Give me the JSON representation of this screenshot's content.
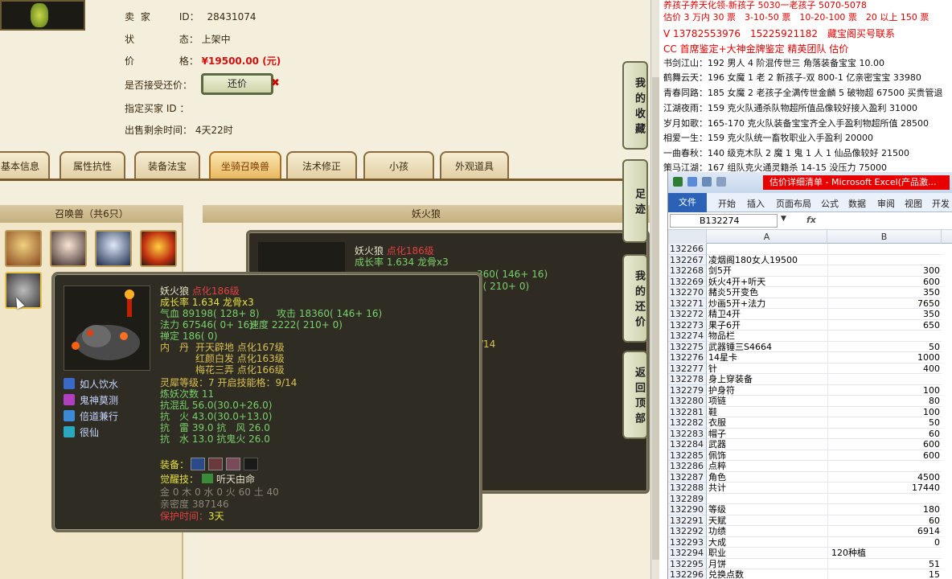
{
  "trade_info": {
    "seller_label": "卖 家",
    "id_label": "ID：",
    "id_value": "28431074",
    "status_label": "状",
    "status_label2": "态：",
    "status_value": "上架中",
    "price_label": "价",
    "price_label2": "格：",
    "price_value": "¥19500.00 (元)",
    "counter_label": "是否接受还价：",
    "counter_button": "还价",
    "buyer_label": "指定买家 ID ：",
    "remaining_label": "出售剩余时间：",
    "remaining_value": "4天22时"
  },
  "tabs": [
    "基本信息",
    "属性抗性",
    "装备法宝",
    "坐骑召唤兽",
    "法术修正",
    "小孩",
    "外观道具"
  ],
  "active_tab": "坐骑召唤兽",
  "summon_panel": {
    "header": "召唤兽（共6只）"
  },
  "right_panel": {
    "header": "妖火狼"
  },
  "side_buttons": [
    "我的收藏",
    "足迹",
    "我的还价",
    "返回顶部"
  ],
  "tooltip": {
    "name": "妖火狼",
    "level": "点化186级",
    "growth": "成长率 1.634 龙骨x3",
    "hp": "气血 89198( 128+ 8)",
    "atk": "攻击 18360( 146+ 16)",
    "mp": "法力 67546( 0+ 16)",
    "spd": "速度 2222( 210+ 0)",
    "def": "禅定 186( 0)",
    "neidan_label": "内　丹",
    "neidan1": "开天辟地 点化167级",
    "neidan2": "红颜白发 点化163级",
    "neidan3": "梅花三弄 点化166级",
    "lingxi": "灵犀等级：7 开启技能格：9/14",
    "lianyao": "炼妖次数 11",
    "res1": "抗混乱 56.0(30.0+26.0)",
    "res2": "抗　火 43.0(30.0+13.0)",
    "res3": "抗　雷 39.0 抗　风 26.0",
    "res4": "抗　水 13.0 抗鬼火 26.0",
    "equip_label": "装备：",
    "awaken_label": "觉醒技：",
    "awaken_value": "听天由命",
    "elements": "金 0 木 0 水 0 火 60 土 40",
    "intimacy": "亲密度 387146",
    "protect_label": "保护时间：",
    "protect_value": "3天",
    "skills": [
      "如人饮水",
      "鬼神莫测",
      "倍道兼行",
      "很仙"
    ],
    "behind_growth": "成长率 1.634 龙骨x3",
    "behind_name": "妖火狼",
    "behind_level": "点化186级",
    "behind_atk": "360( 146+ 16)",
    "behind_spd": "2( 210+ 0)",
    "behind_skill": "/14"
  },
  "annotations": [
    {
      "text": "养孩子养天化领-新孩子 5030一老孩子 5070-5078",
      "color": "#e00000"
    },
    {
      "text": "估价 3 万内 30 票　3-10-50 票　10-20-100 票　20 以上 150 票",
      "color": "#e00000"
    },
    {
      "text": "V 13782553976　15225921182　藏宝阁买号联系",
      "color": "#e00000"
    },
    {
      "text": "CC 首席鉴定+大神金牌鉴定 精英团队 估价",
      "color": "#e00000"
    },
    {
      "text": "书剑江山：192 男人 4 阶混传世三 角落装备宝宝 10.00",
      "color": "#111"
    },
    {
      "text": "鹤舞云天：196 女魔 1 老 2 新孩子-双 800-1 亿亲密宝宝 33980",
      "color": "#111"
    },
    {
      "text": "青春同路：185 女魔 2 老孩子全满传世金麟 5 破物超 67500 买贵管退",
      "color": "#111"
    },
    {
      "text": "江湖夜雨：159 克火队通杀队物超所值品像较好接入盈利 31000",
      "color": "#111"
    },
    {
      "text": "岁月如歌：165-170 克火队装备宝宝齐全入手盈利物超所值 28500",
      "color": "#111"
    },
    {
      "text": "相爱一生：159 克火队统一畜牧职业入手盈利 20000",
      "color": "#111"
    },
    {
      "text": "一曲春秋：140 级克木队 2 魔 1 鬼 1 人 1 仙品像较好 21500",
      "color": "#111"
    },
    {
      "text": "策马江湖：167 组队克火通灵籍杀 14-15 没压力 75000",
      "color": "#111"
    }
  ],
  "excel": {
    "title": "估价详细清单 - Microsoft Excel(产品激...",
    "ribbon": [
      "文件",
      "开始",
      "插入",
      "页面布局",
      "公式",
      "数据",
      "审阅",
      "视图",
      "开发工"
    ],
    "namebox": "B132274",
    "fx": "fx",
    "columns": [
      "A",
      "B"
    ],
    "rows": [
      {
        "n": "132266",
        "a": "",
        "b": ""
      },
      {
        "n": "132267",
        "a": "凌烟阁180女人19500",
        "b": ""
      },
      {
        "n": "132268",
        "a": "剑5开",
        "b": "300"
      },
      {
        "n": "132269",
        "a": "妖火4开+听天",
        "b": "600"
      },
      {
        "n": "132270",
        "a": "赭炎5开变色",
        "b": "350"
      },
      {
        "n": "132271",
        "a": "炒画5开+法力",
        "b": "7650"
      },
      {
        "n": "132272",
        "a": "精卫4开",
        "b": "350"
      },
      {
        "n": "132273",
        "a": "果子6开",
        "b": "650"
      },
      {
        "n": "132274",
        "a": "物品栏",
        "b": ""
      },
      {
        "n": "132275",
        "a": "武器锤三S4664",
        "b": "50"
      },
      {
        "n": "132276",
        "a": "14星卡",
        "b": "1000"
      },
      {
        "n": "132277",
        "a": "针",
        "b": "400"
      },
      {
        "n": "132278",
        "a": "身上穿装备",
        "b": ""
      },
      {
        "n": "132279",
        "a": "护身符",
        "b": "100"
      },
      {
        "n": "132280",
        "a": "项链",
        "b": "80"
      },
      {
        "n": "132281",
        "a": "鞋",
        "b": "100"
      },
      {
        "n": "132282",
        "a": "衣服",
        "b": "50"
      },
      {
        "n": "132283",
        "a": "帽子",
        "b": "60"
      },
      {
        "n": "132284",
        "a": "武器",
        "b": "600"
      },
      {
        "n": "132285",
        "a": "佩饰",
        "b": "600"
      },
      {
        "n": "132286",
        "a": "点粹",
        "b": ""
      },
      {
        "n": "132287",
        "a": "角色",
        "b": "4500"
      },
      {
        "n": "132288",
        "a": "共计",
        "b": "17440"
      },
      {
        "n": "132289",
        "a": "",
        "b": ""
      },
      {
        "n": "132290",
        "a": "等级",
        "b": "180"
      },
      {
        "n": "132291",
        "a": "天赋",
        "b": "60"
      },
      {
        "n": "132292",
        "a": "功绩",
        "b": "6914"
      },
      {
        "n": "132293",
        "a": "大成",
        "b": "0"
      },
      {
        "n": "132294",
        "a": "职业",
        "b": "120种植",
        "left": true
      },
      {
        "n": "132295",
        "a": "月饼",
        "b": "51"
      },
      {
        "n": "132296",
        "a": "兑换点数",
        "b": "15"
      }
    ]
  }
}
